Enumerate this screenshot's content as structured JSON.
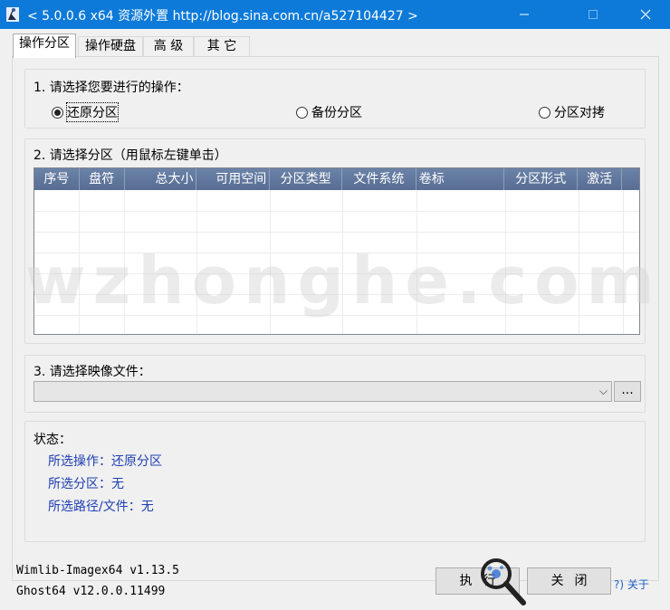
{
  "window": {
    "title": "< 5.0.0.6 x64 资源外置 http://blog.sina.com.cn/a527104427 >",
    "titlebar_color": "#0d7ad9"
  },
  "tabs": [
    {
      "label": "操作分区",
      "active": true
    },
    {
      "label": "操作硬盘",
      "active": false
    },
    {
      "label": "高  级",
      "active": false
    },
    {
      "label": "其  它",
      "active": false
    }
  ],
  "step1": {
    "label": "1. 请选择您要进行的操作：",
    "options": [
      {
        "label": "还原分区",
        "selected": true
      },
      {
        "label": "备份分区",
        "selected": false
      },
      {
        "label": "分区对拷",
        "selected": false
      }
    ]
  },
  "step2": {
    "label": "2. 请选择分区（用鼠标左键单击）",
    "columns": [
      "序号",
      "盘符",
      "总大小",
      "可用空间",
      "分区类型",
      "文件系统",
      "卷标",
      "分区形式",
      "激活"
    ],
    "header_color": "#5f769c"
  },
  "step3": {
    "label": "3. 请选择映像文件：",
    "browse_label": "..."
  },
  "status": {
    "label": "状态：",
    "operation": "所选操作：还原分区",
    "partition": "所选分区：无",
    "path": "所选路径/文件：无",
    "text_color": "#1f3fb3"
  },
  "footer": {
    "wimlib_version": "Wimlib-Imagex64 v1.13.5",
    "ghost_version": "Ghost64 v12.0.0.11499",
    "execute_label": "执行",
    "close_label": "关闭",
    "about_label": "?) 关于"
  },
  "watermark": {
    "text": "wzhonghe.com"
  }
}
